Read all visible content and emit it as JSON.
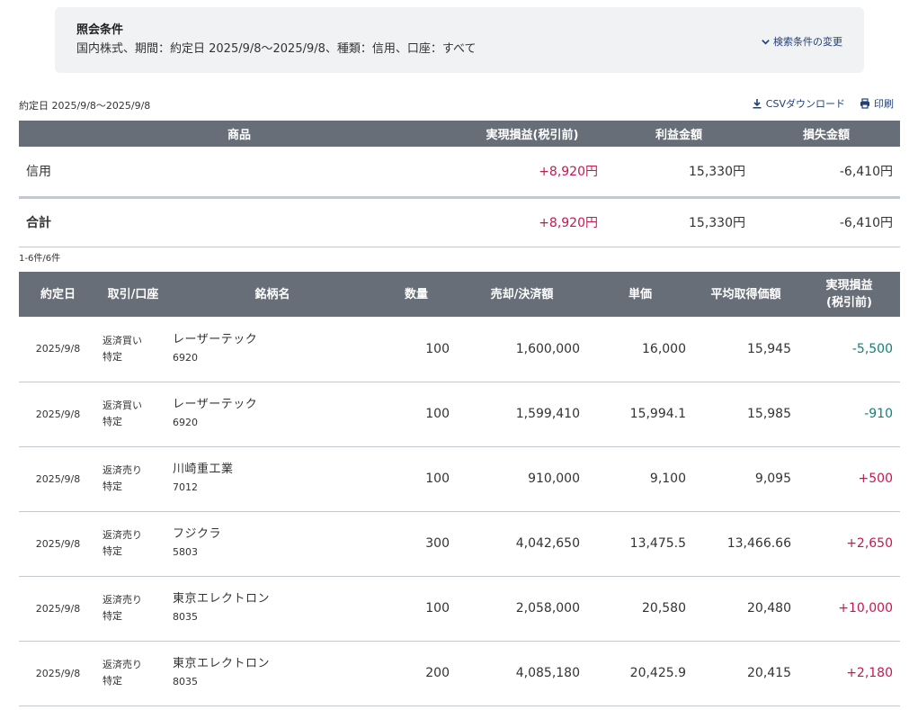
{
  "condition": {
    "title": "照会条件",
    "text": "国内株式、期間：約定日 2025/9/8〜2025/9/8、種類：信用、口座：すべて",
    "change_label": "検索条件の変更"
  },
  "date_range": "約定日 2025/9/8〜2025/9/8",
  "tools": {
    "csv_label": "CSVダウンロード",
    "print_label": "印刷"
  },
  "summary": {
    "headers": [
      "商品",
      "実現損益(税引前)",
      "利益金額",
      "損失金額"
    ],
    "rows": [
      {
        "name": "信用",
        "pl": "+8,920円",
        "profit": "15,330円",
        "loss": "-6,410円"
      },
      {
        "name": "合計",
        "pl": "+8,920円",
        "profit": "15,330円",
        "loss": "-6,410円"
      }
    ]
  },
  "count_text": "1-6件/6件",
  "detail": {
    "headers": {
      "date": "約定日",
      "trade": "取引/口座",
      "stock": "銘柄名",
      "qty": "数量",
      "amount": "売却/決済額",
      "price": "単価",
      "avg": "平均取得価額",
      "pl_line1": "実現損益",
      "pl_line2": "(税引前)"
    },
    "rows": [
      {
        "date": "2025/9/8",
        "trade": "返済買い",
        "account": "特定",
        "name": "レーザーテック",
        "code": "6920",
        "qty": "100",
        "amount": "1,600,000",
        "price": "16,000",
        "avg": "15,945",
        "pl": "-5,500"
      },
      {
        "date": "2025/9/8",
        "trade": "返済買い",
        "account": "特定",
        "name": "レーザーテック",
        "code": "6920",
        "qty": "100",
        "amount": "1,599,410",
        "price": "15,994.1",
        "avg": "15,985",
        "pl": "-910"
      },
      {
        "date": "2025/9/8",
        "trade": "返済売り",
        "account": "特定",
        "name": "川崎重工業",
        "code": "7012",
        "qty": "100",
        "amount": "910,000",
        "price": "9,100",
        "avg": "9,095",
        "pl": "+500"
      },
      {
        "date": "2025/9/8",
        "trade": "返済売り",
        "account": "特定",
        "name": "フジクラ",
        "code": "5803",
        "qty": "300",
        "amount": "4,042,650",
        "price": "13,475.5",
        "avg": "13,466.66",
        "pl": "+2,650"
      },
      {
        "date": "2025/9/8",
        "trade": "返済売り",
        "account": "特定",
        "name": "東京エレクトロン",
        "code": "8035",
        "qty": "100",
        "amount": "2,058,000",
        "price": "20,580",
        "avg": "20,480",
        "pl": "+10,000"
      },
      {
        "date": "2025/9/8",
        "trade": "返済売り",
        "account": "特定",
        "name": "東京エレクトロン",
        "code": "8035",
        "qty": "200",
        "amount": "4,085,180",
        "price": "20,425.9",
        "avg": "20,415",
        "pl": "+2,180"
      }
    ]
  },
  "colors": {
    "positive": "#c8174f",
    "negative": "#12807a",
    "header_bg": "#686e78",
    "link": "#1f3f7a"
  }
}
